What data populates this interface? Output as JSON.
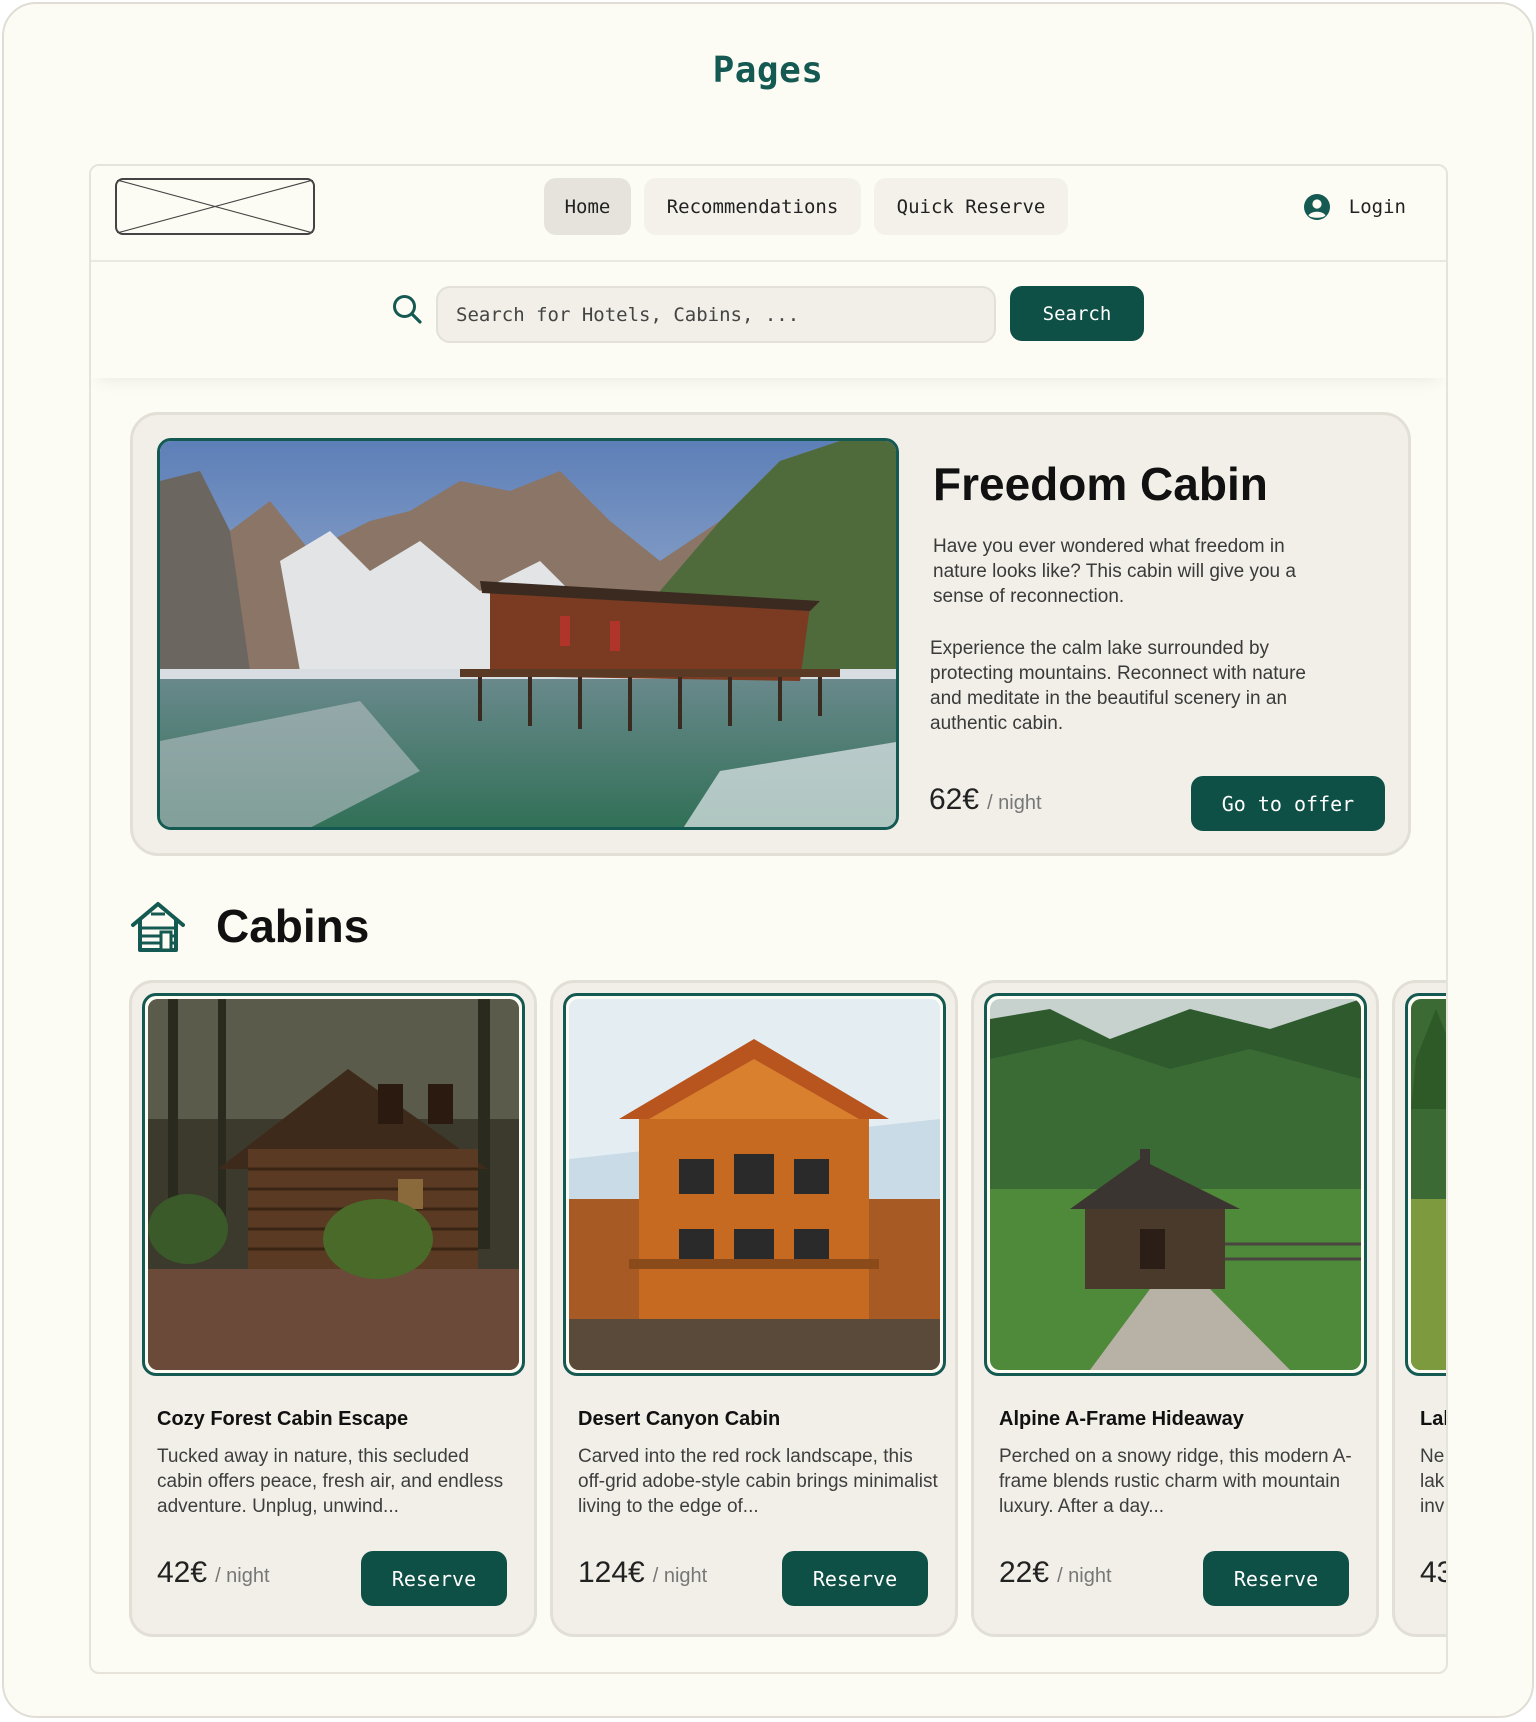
{
  "page": {
    "title": "Pages"
  },
  "nav": {
    "tabs": [
      {
        "label": "Home",
        "active": true
      },
      {
        "label": "Recommendations",
        "active": false
      },
      {
        "label": "Quick Reserve",
        "active": false
      }
    ],
    "login_label": "Login",
    "icons": {
      "login": "user-circle-icon",
      "logo": "image-placeholder-icon"
    }
  },
  "search": {
    "placeholder": "Search for Hotels, Cabins, ...",
    "button_label": "Search",
    "icon": "search-icon"
  },
  "featured": {
    "title": "Freedom Cabin",
    "description_1": "Have you ever wondered what freedom in nature looks like? This cabin will give you a sense of reconnection.",
    "description_2": "Experience the calm lake surrounded by protecting mountains. Reconnect with nature and meditate in the beautiful scenery in an authentic cabin.",
    "price": "62€",
    "price_unit": "/ night",
    "button_label": "Go to offer"
  },
  "cabins_section": {
    "title": "Cabins",
    "icon": "cabin-icon",
    "cards": [
      {
        "title": "Cozy Forest Cabin Escape",
        "description": "Tucked away in nature, this secluded cabin offers peace, fresh air, and endless adventure. Unplug, unwind...",
        "price": "42€",
        "price_unit": "/ night",
        "button_label": "Reserve"
      },
      {
        "title": "Desert Canyon Cabin",
        "description": " Carved into the red rock landscape, this off-grid adobe-style cabin brings minimalist living to the edge of...",
        "price": "124€",
        "price_unit": "/ night",
        "button_label": "Reserve"
      },
      {
        "title": "Alpine A-Frame Hideaway",
        "description": " Perched on a snowy ridge, this modern A-frame blends rustic charm with mountain luxury. After a day...",
        "price": "22€",
        "price_unit": "/ night",
        "button_label": "Reserve"
      },
      {
        "title": "Lal",
        "description": " Ne lak inv",
        "price": "43",
        "price_unit": "",
        "button_label": ""
      }
    ]
  },
  "colors": {
    "accent": "#0e4f46",
    "title": "#155a52",
    "background": "#fdfcf4",
    "card": "#f1efe7"
  }
}
